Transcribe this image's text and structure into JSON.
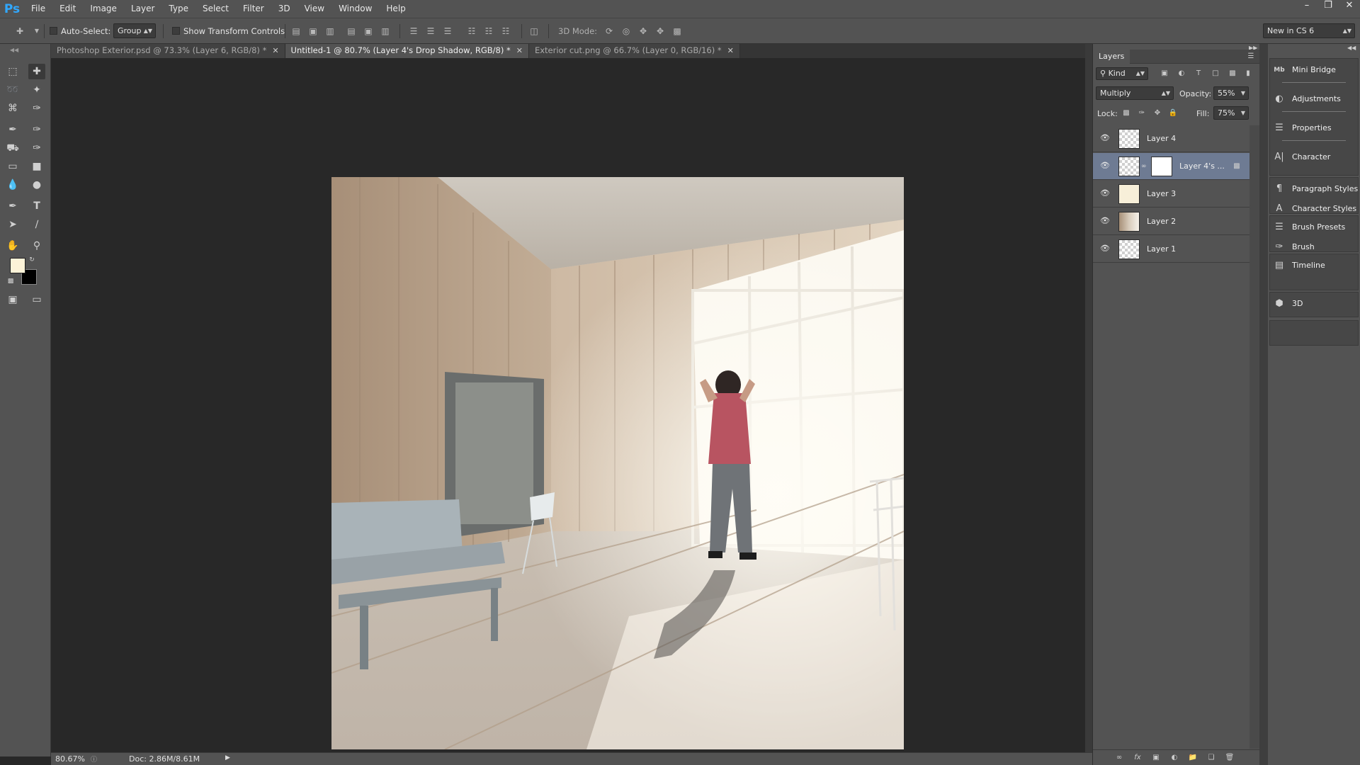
{
  "app": {
    "logo": "Ps",
    "menu": [
      "File",
      "Edit",
      "Image",
      "Layer",
      "Type",
      "Select",
      "Filter",
      "3D",
      "View",
      "Window",
      "Help"
    ],
    "window_controls": [
      "–",
      "❐",
      "✕"
    ]
  },
  "options": {
    "auto_select_label": "Auto-Select:",
    "auto_select_value": "Group",
    "transform_label": "Show Transform Controls",
    "mode3d_label": "3D Mode:",
    "workspace": "New in CS 6"
  },
  "tabs": [
    {
      "label": "Photoshop Exterior.psd @ 73.3% (Layer 6, RGB/8) *",
      "active": false
    },
    {
      "label": "Untitled-1 @ 80.7% (Layer 4's Drop Shadow, RGB/8) *",
      "active": true
    },
    {
      "label": "Exterior cut.png @ 66.7% (Layer 0, RGB/16) *",
      "active": false
    }
  ],
  "status": {
    "zoom": "80.67%",
    "doc": "Doc: 2.86M/8.61M"
  },
  "layers_panel": {
    "title": "Layers",
    "filter_kind": "Kind",
    "blend_mode": "Multiply",
    "opacity_label": "Opacity:",
    "opacity_value": "55%",
    "lock_label": "Lock:",
    "fill_label": "Fill:",
    "fill_value": "75%",
    "layers": [
      {
        "name": "Layer 4",
        "selected": false
      },
      {
        "name": "Layer 4's ...",
        "selected": true
      },
      {
        "name": "Layer 3",
        "selected": false
      },
      {
        "name": "Layer 2",
        "selected": false
      },
      {
        "name": "Layer 1",
        "selected": false
      }
    ]
  },
  "dock": {
    "items": [
      {
        "label": "Mini Bridge",
        "icon": "mini-bridge-icon"
      },
      {
        "label": "Adjustments",
        "icon": "adjustments-icon"
      },
      {
        "label": "Properties",
        "icon": "properties-icon"
      },
      {
        "label": "Character",
        "icon": "character-icon"
      },
      {
        "label": "Paragraph Styles",
        "icon": "paragraph-styles-icon"
      },
      {
        "label": "Character Styles",
        "icon": "character-styles-icon"
      },
      {
        "label": "Brush Presets",
        "icon": "brush-presets-icon"
      },
      {
        "label": "Brush",
        "icon": "brush-icon"
      },
      {
        "label": "Timeline",
        "icon": "timeline-icon"
      },
      {
        "label": "3D",
        "icon": "3d-icon"
      }
    ]
  },
  "colors": {
    "foreground": "#fdf3d8",
    "background": "#000000",
    "ps_blue": "#31a8ff",
    "selected_layer": "#6e7b93"
  }
}
